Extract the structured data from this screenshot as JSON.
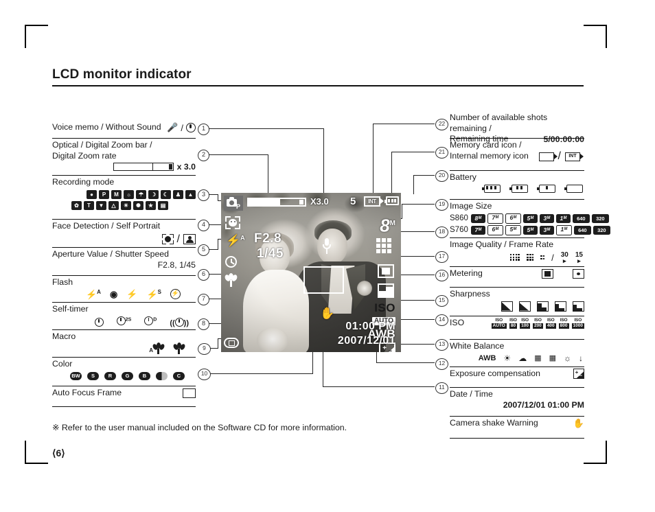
{
  "page": {
    "title": "LCD monitor indicator",
    "note": "※ Refer to the user manual included on the Software CD for more information.",
    "page_number": "⟨6⟩"
  },
  "left_column": [
    {
      "num": "1",
      "label": "Voice memo / Without Sound",
      "value": ""
    },
    {
      "num": "2",
      "label": "Optical / Digital Zoom bar /\nDigital Zoom rate",
      "value": "x 3.0"
    },
    {
      "num": "3",
      "label": "Recording mode",
      "value": ""
    },
    {
      "num": "4",
      "label": "Face Detection / Self Portrait",
      "value": ""
    },
    {
      "num": "5",
      "label": "Aperture Value / Shutter Speed",
      "value": "F2.8, 1/45"
    },
    {
      "num": "6",
      "label": "Flash",
      "value": ""
    },
    {
      "num": "7",
      "label": "Self-timer",
      "value": ""
    },
    {
      "num": "8",
      "label": "Macro",
      "value": ""
    },
    {
      "num": "9",
      "label": "Color",
      "value": ""
    },
    {
      "num": "10",
      "label": "Auto Focus Frame",
      "value": ""
    }
  ],
  "right_column": [
    {
      "num": "22",
      "label": "Number of available shots remaining /\nRemaining time",
      "value": "5/00:00:00"
    },
    {
      "num": "21",
      "label": "Memory card icon /\nInternal memory icon",
      "value": ""
    },
    {
      "num": "20",
      "label": "Battery",
      "value": ""
    },
    {
      "num": "19",
      "label": "Image Size",
      "value": ""
    },
    {
      "num": "18",
      "label": "Image Quality / Frame Rate",
      "value": ""
    },
    {
      "num": "17",
      "label": "Metering",
      "value": ""
    },
    {
      "num": "16",
      "label": "Sharpness",
      "value": ""
    },
    {
      "num": "15",
      "label": "ISO",
      "value": ""
    },
    {
      "num": "14",
      "label": "White Balance",
      "value": ""
    },
    {
      "num": "13",
      "label": "Exposure compensation",
      "value": ""
    },
    {
      "num": "12",
      "label": "Date / Time",
      "value": "2007/12/01  01:00 PM"
    },
    {
      "num": "11",
      "label": "Camera shake Warning",
      "value": ""
    }
  ],
  "icons": {
    "voice_memo": "microphone-icon",
    "without_sound": "microphone-muted-icon",
    "separator": "/",
    "recording_modes_row1": [
      "auto",
      "program",
      "M",
      "dis",
      "photo-help",
      "effect",
      "night",
      "portrait",
      "landscape"
    ],
    "recording_modes_row2": [
      "close-up",
      "text",
      "sunset",
      "dawn",
      "backlight",
      "fireworks",
      "beach-snow",
      "movie"
    ],
    "face_detection": "face-detection-icon",
    "self_portrait": "self-portrait-icon",
    "flash_modes": [
      "auto-flash",
      "red-eye",
      "fill-in",
      "slow-sync",
      "flash-off"
    ],
    "self_timer_modes": [
      "10sec",
      "2sec",
      "double",
      "motion"
    ],
    "macro_modes": [
      "auto-macro",
      "macro"
    ],
    "color_modes": [
      "BW",
      "S",
      "R",
      "G",
      "B",
      "custom",
      "C"
    ],
    "auto_focus_frame": "focus-frame-icon",
    "memory_card": "card-icon",
    "internal_memory": "INT",
    "battery_levels": 4,
    "metering_modes": [
      "multi",
      "spot"
    ],
    "sharpness_levels": 5,
    "exposure_comp": "ev-icon",
    "camera_shake": "shake-warning-icon"
  },
  "image_size": {
    "row_labels": [
      "S860",
      "S760"
    ],
    "s860": [
      "8ᴹ",
      "7ᴹ",
      "6ᴹ",
      "5ᴹ",
      "3ᴹ",
      "1ᴹ",
      "640",
      "320"
    ],
    "s760": [
      "7ᴹ",
      "6ᴹ",
      "5ᴹ",
      "5ᴹ",
      "3ᴹ",
      "1ᴹ",
      "640",
      "320"
    ]
  },
  "image_quality": {
    "levels": [
      "super-fine",
      "fine",
      "normal"
    ],
    "frame_rates": [
      "30",
      "15"
    ],
    "separator": "/"
  },
  "iso": {
    "label": "ISO",
    "values": [
      "AUTO",
      "80",
      "100",
      "200",
      "400",
      "800",
      "1000"
    ]
  },
  "white_balance": {
    "values": [
      "AWB",
      "daylight",
      "cloudy",
      "fluorescent-h",
      "fluorescent-l",
      "tungsten",
      "custom"
    ]
  },
  "lcd": {
    "mode_badge": "P",
    "zoom_rate": "X3.0",
    "shots_remaining": "5",
    "memory_icon": "INT",
    "aperture": "F2.8",
    "shutter": "1/45",
    "image_size": "8",
    "image_size_unit": "M",
    "iso_label": "ISO",
    "iso_value": "AUTO",
    "white_balance": "AWB",
    "time": "01:00 PM",
    "date": "2007/12/01"
  }
}
